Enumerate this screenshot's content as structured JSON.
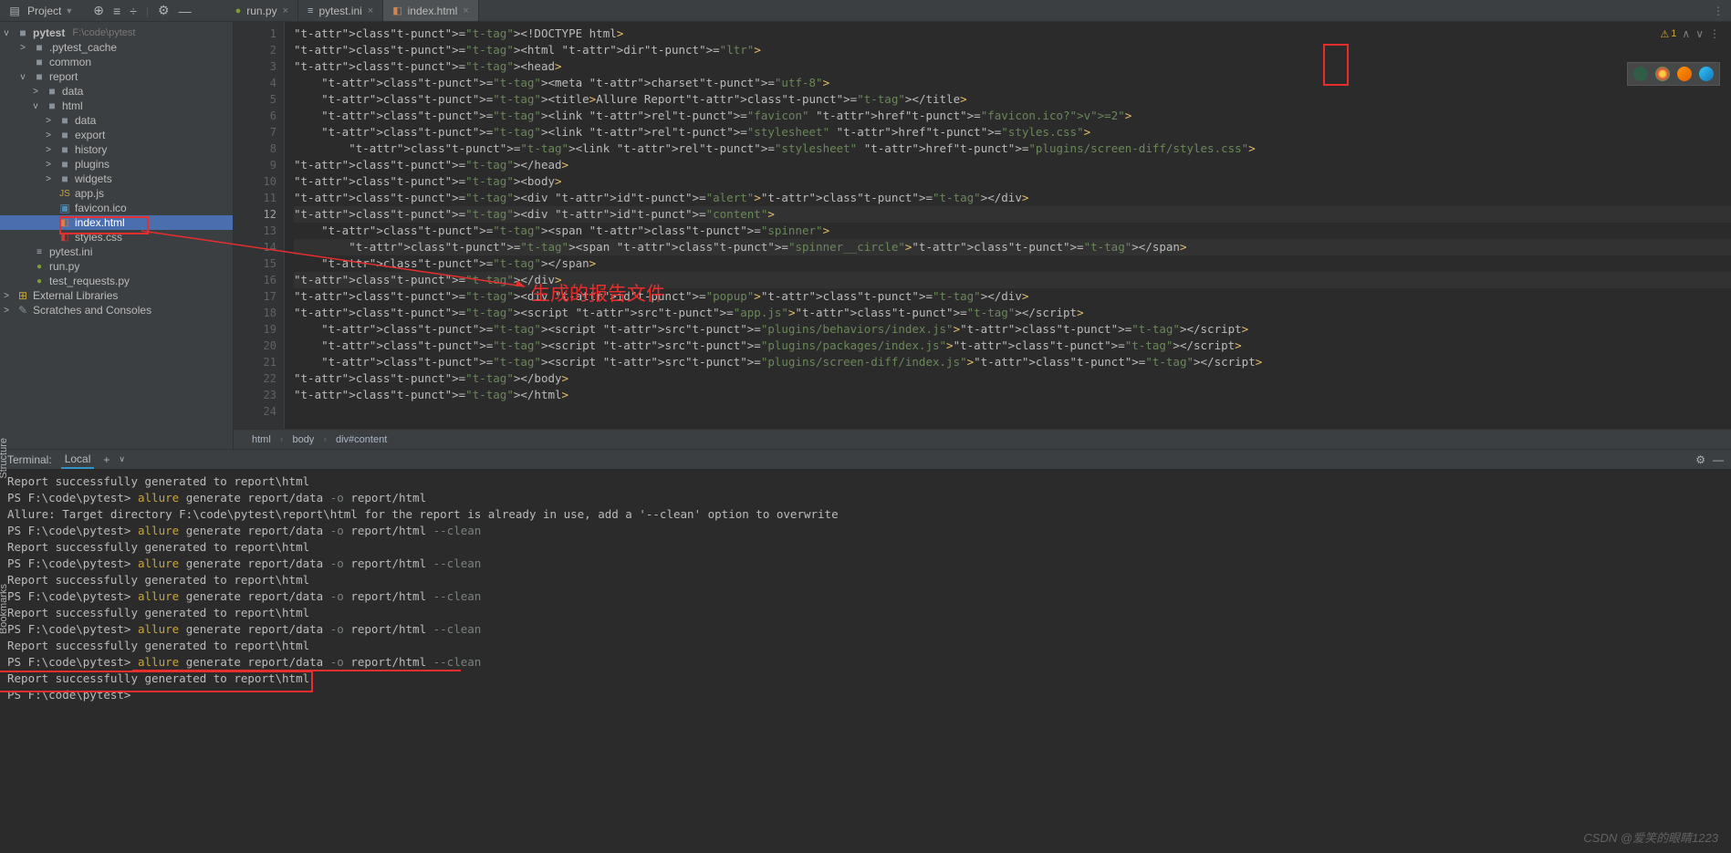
{
  "topbar": {
    "project_label": "Project"
  },
  "tabs": [
    {
      "icon": "py",
      "label": "run.py",
      "active": false
    },
    {
      "icon": "ini",
      "label": "pytest.ini",
      "active": false
    },
    {
      "icon": "html",
      "label": "index.html",
      "active": true
    }
  ],
  "tree": {
    "root": "pytest",
    "root_path": "F:\\code\\pytest",
    "items": [
      {
        "indent": 1,
        "chev": ">",
        "icon": "folder",
        "label": ".pytest_cache"
      },
      {
        "indent": 1,
        "chev": "",
        "icon": "folder",
        "label": "common"
      },
      {
        "indent": 1,
        "chev": "v",
        "icon": "folder",
        "label": "report"
      },
      {
        "indent": 2,
        "chev": ">",
        "icon": "folder",
        "label": "data"
      },
      {
        "indent": 2,
        "chev": "v",
        "icon": "folder",
        "label": "html"
      },
      {
        "indent": 3,
        "chev": ">",
        "icon": "folder",
        "label": "data"
      },
      {
        "indent": 3,
        "chev": ">",
        "icon": "folder",
        "label": "export"
      },
      {
        "indent": 3,
        "chev": ">",
        "icon": "folder",
        "label": "history"
      },
      {
        "indent": 3,
        "chev": ">",
        "icon": "folder",
        "label": "plugins"
      },
      {
        "indent": 3,
        "chev": ">",
        "icon": "folder",
        "label": "widgets"
      },
      {
        "indent": 3,
        "chev": "",
        "icon": "js",
        "label": "app.js"
      },
      {
        "indent": 3,
        "chev": "",
        "icon": "img",
        "label": "favicon.ico"
      },
      {
        "indent": 3,
        "chev": "",
        "icon": "html",
        "label": "index.html",
        "selected": true
      },
      {
        "indent": 3,
        "chev": "",
        "icon": "css",
        "label": "styles.css"
      },
      {
        "indent": 1,
        "chev": "",
        "icon": "ini",
        "label": "pytest.ini"
      },
      {
        "indent": 1,
        "chev": "",
        "icon": "py",
        "label": "run.py"
      },
      {
        "indent": 1,
        "chev": "",
        "icon": "py",
        "label": "test_requests.py"
      }
    ],
    "extras": [
      {
        "icon": "lib",
        "label": "External Libraries"
      },
      {
        "icon": "scratch",
        "label": "Scratches and Consoles"
      }
    ]
  },
  "editor": {
    "warning_count": "1",
    "current_line": 12,
    "lines": [
      "<!DOCTYPE html>",
      "<html dir=\"ltr\">",
      "<head>",
      "    <meta charset=\"utf-8\">",
      "    <title>Allure Report</title>",
      "    <link rel=\"favicon\" href=\"favicon.ico?v=2\">",
      "    <link rel=\"stylesheet\" href=\"styles.css\">",
      "        <link rel=\"stylesheet\" href=\"plugins/screen-diff/styles.css\">",
      "</head>",
      "<body>",
      "<div id=\"alert\"></div>",
      "<div id=\"content\">",
      "    <span class=\"spinner\">",
      "        <span class=\"spinner__circle\"></span>",
      "    </span>",
      "</div>",
      "<div id=\"popup\"></div>",
      "<script src=\"app.js\"></script>",
      "    <script src=\"plugins/behaviors/index.js\"></script>",
      "    <script src=\"plugins/packages/index.js\"></script>",
      "    <script src=\"plugins/screen-diff/index.js\"></script>",
      "</body>",
      "</html>",
      ""
    ]
  },
  "breadcrumb": [
    "html",
    "body",
    "div#content"
  ],
  "terminal": {
    "tab_group_label": "Terminal:",
    "tab_label": "Local",
    "lines": [
      {
        "parts": [
          {
            "cls": "t-text",
            "txt": "Report successfully generated to report\\html"
          }
        ]
      },
      {
        "parts": [
          {
            "cls": "t-prompt",
            "txt": "PS F:\\code\\pytest> "
          },
          {
            "cls": "t-cmd",
            "txt": "allure "
          },
          {
            "cls": "t-arg",
            "txt": "generate report/data "
          },
          {
            "cls": "t-opt",
            "txt": "-o "
          },
          {
            "cls": "t-arg",
            "txt": "report/html"
          }
        ]
      },
      {
        "parts": [
          {
            "cls": "t-text",
            "txt": "Allure: Target directory F:\\code\\pytest\\report\\html for the report is already in use, add a '--clean' option to overwrite"
          }
        ]
      },
      {
        "parts": [
          {
            "cls": "t-prompt",
            "txt": "PS F:\\code\\pytest> "
          },
          {
            "cls": "t-cmd",
            "txt": "allure "
          },
          {
            "cls": "t-arg",
            "txt": "generate report/data "
          },
          {
            "cls": "t-opt",
            "txt": "-o "
          },
          {
            "cls": "t-arg",
            "txt": "report/html "
          },
          {
            "cls": "t-opt",
            "txt": "--clean"
          }
        ]
      },
      {
        "parts": [
          {
            "cls": "t-text",
            "txt": "Report successfully generated to report\\html"
          }
        ]
      },
      {
        "parts": [
          {
            "cls": "t-prompt",
            "txt": "PS F:\\code\\pytest> "
          },
          {
            "cls": "t-cmd",
            "txt": "allure "
          },
          {
            "cls": "t-arg",
            "txt": "generate report/data "
          },
          {
            "cls": "t-opt",
            "txt": "-o "
          },
          {
            "cls": "t-arg",
            "txt": "report/html "
          },
          {
            "cls": "t-opt",
            "txt": "--clean"
          }
        ]
      },
      {
        "parts": [
          {
            "cls": "t-text",
            "txt": "Report successfully generated to report\\html"
          }
        ]
      },
      {
        "parts": [
          {
            "cls": "t-prompt",
            "txt": "PS F:\\code\\pytest> "
          },
          {
            "cls": "t-cmd",
            "txt": "allure "
          },
          {
            "cls": "t-arg",
            "txt": "generate report/data "
          },
          {
            "cls": "t-opt",
            "txt": "-o "
          },
          {
            "cls": "t-arg",
            "txt": "report/html "
          },
          {
            "cls": "t-opt",
            "txt": "--clean"
          }
        ]
      },
      {
        "parts": [
          {
            "cls": "t-text",
            "txt": "Report successfully generated to report\\html"
          }
        ]
      },
      {
        "parts": [
          {
            "cls": "t-prompt",
            "txt": "PS F:\\code\\pytest> "
          },
          {
            "cls": "t-cmd",
            "txt": "allure "
          },
          {
            "cls": "t-arg",
            "txt": "generate report/data "
          },
          {
            "cls": "t-opt",
            "txt": "-o "
          },
          {
            "cls": "t-arg",
            "txt": "report/html "
          },
          {
            "cls": "t-opt",
            "txt": "--clean"
          }
        ]
      },
      {
        "parts": [
          {
            "cls": "t-text",
            "txt": "Report successfully generated to report\\html"
          }
        ]
      },
      {
        "parts": [
          {
            "cls": "t-prompt",
            "txt": "PS F:\\code\\pytest> "
          },
          {
            "cls": "t-cmd",
            "txt": "allure "
          },
          {
            "cls": "t-arg",
            "txt": "generate report/data "
          },
          {
            "cls": "t-opt",
            "txt": "-o "
          },
          {
            "cls": "t-arg",
            "txt": "report/html "
          },
          {
            "cls": "t-opt",
            "txt": "--clean"
          }
        ],
        "underline": true
      },
      {
        "parts": [
          {
            "cls": "t-text",
            "txt": "Report successfully generated to report\\html"
          }
        ]
      },
      {
        "parts": [
          {
            "cls": "t-prompt",
            "txt": "PS F:\\code\\pytest> "
          }
        ]
      }
    ]
  },
  "annotation": "生成的报告文件",
  "watermark": "CSDN @爱笑的眼睛1223"
}
